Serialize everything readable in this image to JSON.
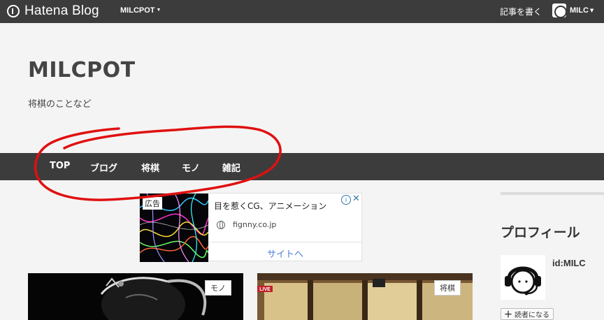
{
  "topbar": {
    "brand": "Hatena Blog",
    "blog_switch": "MILCPOT",
    "write_link": "記事を書く",
    "user_name": "MILC"
  },
  "header": {
    "title": "MILCPOT",
    "description": "将棋のことなど"
  },
  "category_nav": {
    "items": [
      {
        "label": "TOP"
      },
      {
        "label": "ブログ"
      },
      {
        "label": "将棋"
      },
      {
        "label": "モノ"
      },
      {
        "label": "雑記"
      }
    ]
  },
  "ad": {
    "badge": "広告",
    "title": "目を惹くCG、アニメーション",
    "domain": "fignny.co.jp",
    "cta": "サイトへ",
    "info_icon": "info-icon",
    "close_icon": "close-icon"
  },
  "articles": [
    {
      "tag": "モノ"
    },
    {
      "tag": "将棋",
      "live_badge": "LIVE"
    }
  ],
  "sidebar": {
    "profile_heading": "プロフィール",
    "profile_id": "id:MILC",
    "follow_label": "読者になる"
  },
  "colors": {
    "topbar": "#3c3c3c",
    "page_bg": "#f4f4f4",
    "annotation": "#e01010",
    "ad_cta": "#4a7fd6"
  }
}
